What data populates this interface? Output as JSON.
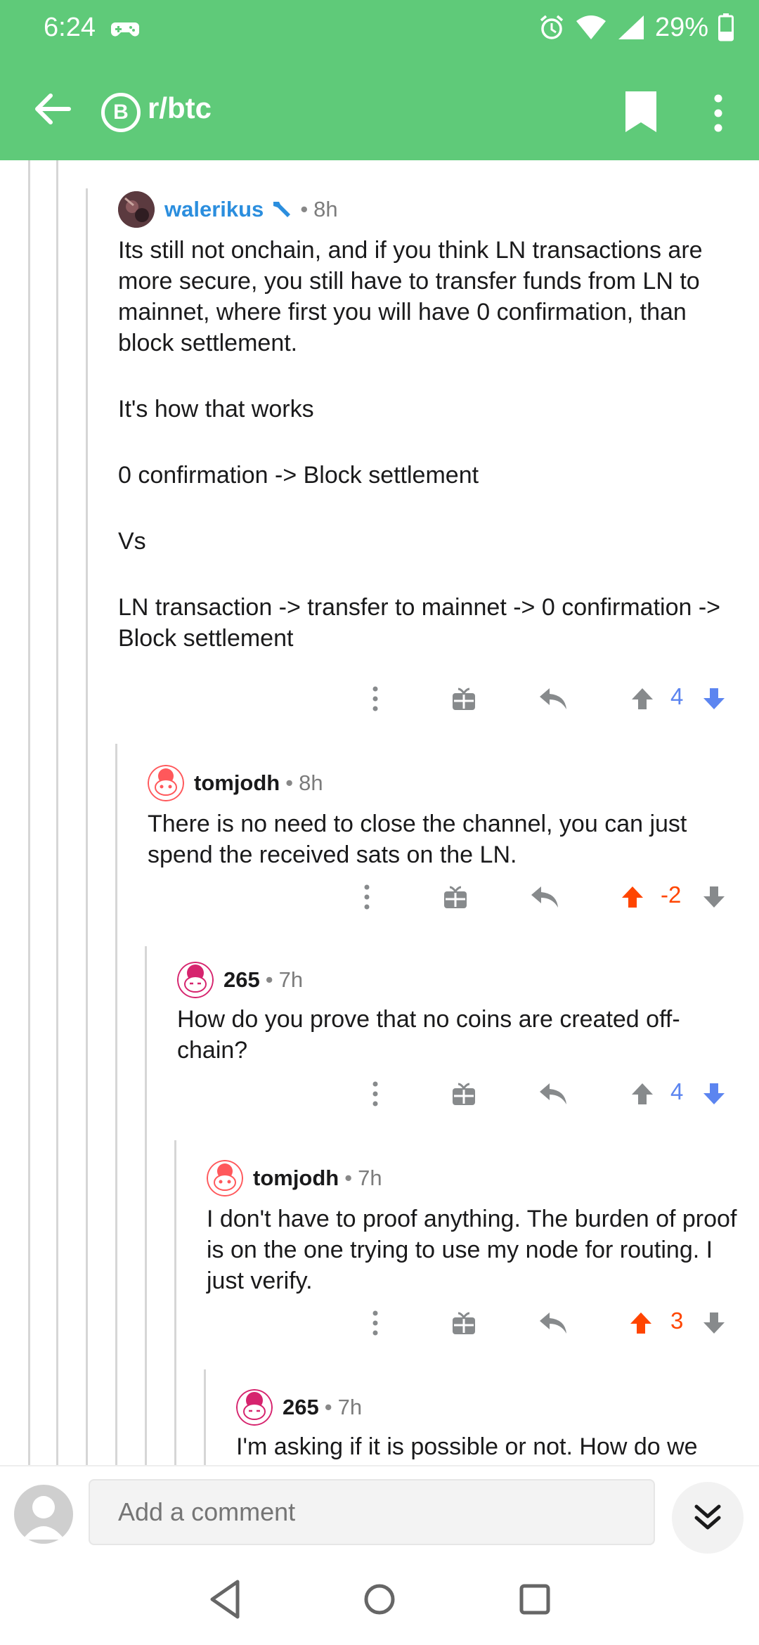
{
  "status_bar": {
    "time": "6:24",
    "battery": "29%"
  },
  "toolbar": {
    "subreddit": "r/btc",
    "subreddit_icon_glyph": "B"
  },
  "colors": {
    "header_green": "#5fca79",
    "op_blue": "#2b8ede",
    "upvote_orange": "#ff4500",
    "vote_blue": "#5c85f0"
  },
  "comments": [
    {
      "author": "walerikus",
      "age": "8h",
      "paragraphs": [
        "Its still not onchain, and if you think LN transactions are more secure, you still have to transfer funds from LN to mainnet, where first you will have 0 confirmation, than block settlement.",
        "It's how that works",
        "0 confirmation -> Block settlement",
        "Vs",
        "LN transaction -> transfer to mainnet -> 0 confirmation -> Block settlement"
      ],
      "score": "4"
    },
    {
      "author": "tomjodh",
      "age": "8h",
      "paragraphs": [
        "There is no need to close the channel, you can just spend the received sats on the LN."
      ],
      "score": "-2"
    },
    {
      "author": "265",
      "age": "7h",
      "paragraphs": [
        "How do you prove that no coins are created off-chain?"
      ],
      "score": "4"
    },
    {
      "author": "tomjodh",
      "age": "7h",
      "paragraphs": [
        "I don't have to proof anything. The burden of proof is on the one trying to use my node for routing. I just verify."
      ],
      "score": "3"
    },
    {
      "author": "265",
      "age": "7h",
      "paragraphs": [
        "I'm asking if it is possible or not. How do we know that the number of coins are less than"
      ],
      "score": ""
    }
  ],
  "meta_separator": "•",
  "bottom_bar": {
    "placeholder": "Add a comment"
  }
}
